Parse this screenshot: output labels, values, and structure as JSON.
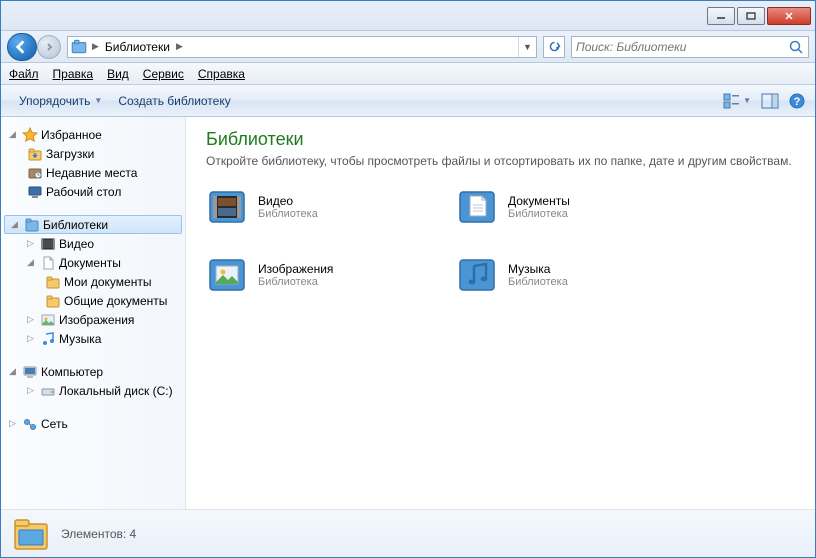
{
  "titlebar": {
    "min": "_",
    "max": "▢",
    "close": "✕"
  },
  "address": {
    "crumb": "Библиотеки",
    "search_placeholder": "Поиск: Библиотеки"
  },
  "menu": {
    "file": "Файл",
    "edit": "Правка",
    "view": "Вид",
    "tools": "Сервис",
    "help": "Справка"
  },
  "toolbar": {
    "organize": "Упорядочить",
    "newlib": "Создать библиотеку"
  },
  "sidebar": {
    "favorites": "Избранное",
    "downloads": "Загрузки",
    "recent": "Недавние места",
    "desktop": "Рабочий стол",
    "libraries": "Библиотеки",
    "video": "Видео",
    "documents": "Документы",
    "mydocs": "Мои документы",
    "publicdocs": "Общие документы",
    "pictures": "Изображения",
    "music": "Музыка",
    "computer": "Компьютер",
    "localdisk": "Локальный диск (C:)",
    "network": "Сеть"
  },
  "content": {
    "title": "Библиотеки",
    "subtitle": "Откройте библиотеку, чтобы просмотреть файлы и отсортировать их по папке, дате и другим свойствам.",
    "items": [
      {
        "name": "Видео",
        "type": "Библиотека"
      },
      {
        "name": "Документы",
        "type": "Библиотека"
      },
      {
        "name": "Изображения",
        "type": "Библиотека"
      },
      {
        "name": "Музыка",
        "type": "Библиотека"
      }
    ]
  },
  "status": {
    "count_label": "Элементов: 4"
  }
}
